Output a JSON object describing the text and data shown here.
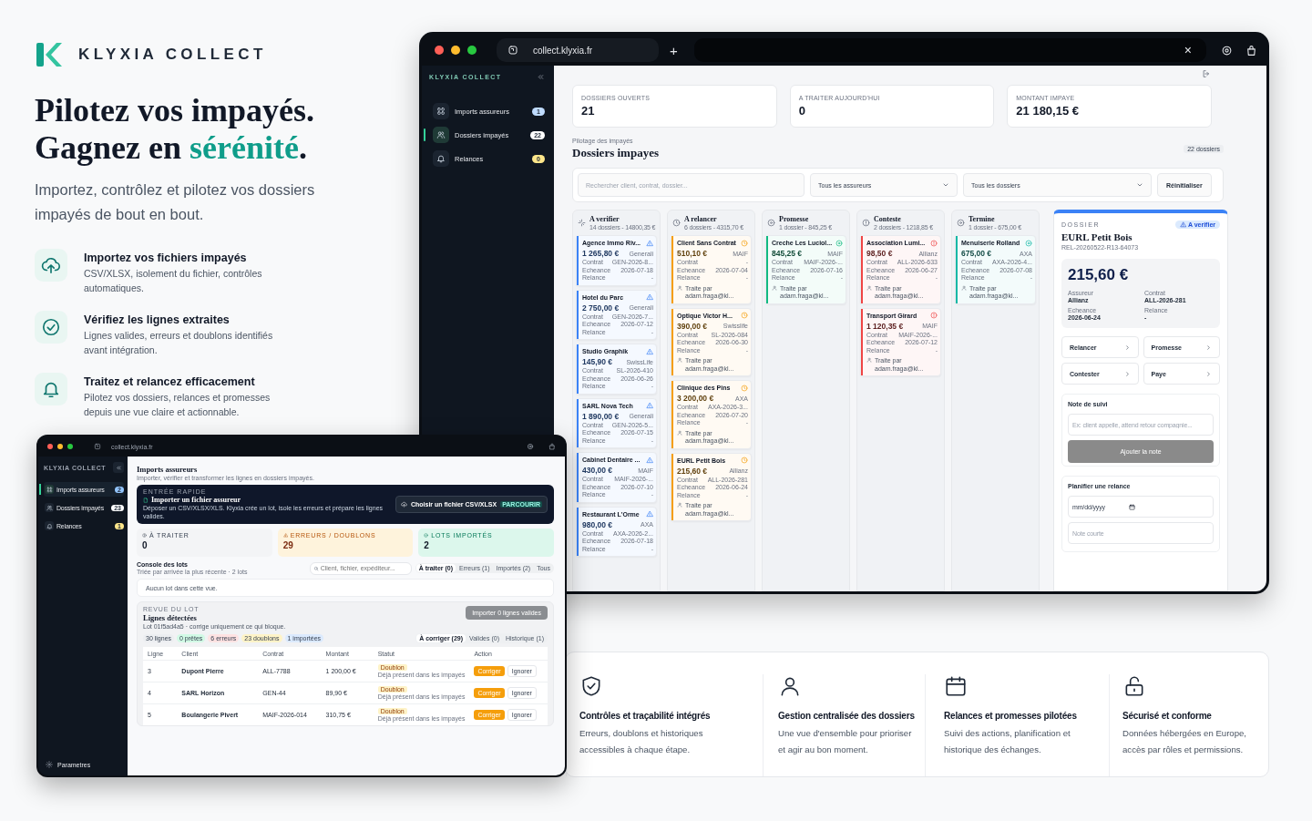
{
  "brand": {
    "name": "KLYXIA COLLECT"
  },
  "hero": {
    "title_line": "Pilotez vos impayés.",
    "title_lead": "Gagnez en ",
    "title_accent": "sérénité",
    "title_tail": ".",
    "subtitle": "Importez, contrôlez et pilotez vos dossiers impayés de bout en bout.",
    "features": [
      {
        "title": "Importez vos fichiers impayés",
        "text": "CSV/XLSX, isolement du fichier, contrôles automatiques."
      },
      {
        "title": "Vérifiez les lignes extraites",
        "text": "Lignes valides, erreurs et doublons identifiés avant intégration."
      },
      {
        "title": "Traitez et relancez efficacement",
        "text": "Pilotez vos dossiers, relances et promesses depuis une vue claire et actionnable."
      }
    ]
  },
  "main_window": {
    "url": "collect.klyxia.fr",
    "tab_new": "+",
    "tab_close": "×",
    "sidebar_brand": "KLYXIA COLLECT",
    "nav": [
      {
        "label": "Imports assureurs",
        "count": "1",
        "selected": false,
        "color": "#bfdbfe"
      },
      {
        "label": "Dossiers impayés",
        "count": "22",
        "selected": true,
        "color": "#ffffff"
      },
      {
        "label": "Relances",
        "count": "0",
        "selected": false,
        "color": "#fde68a"
      }
    ],
    "stats": [
      {
        "label": "DOSSIERS OUVERTS",
        "value": "21"
      },
      {
        "label": "A TRAITER AUJOURD'HUI",
        "value": "0"
      },
      {
        "label": "MONTANT IMPAYE",
        "value": "21 180,15 €"
      }
    ],
    "breadcrumb": "Pilotage des impayés",
    "title": "Dossiers impayes",
    "count": "22 dossiers",
    "search": {
      "placeholder": "Rechercher client, contrat, dossier..."
    },
    "selects": [
      "Tous les assureurs",
      "Tous les dossiers"
    ],
    "reset": "Réinitialiser",
    "columns": [
      {
        "title": "A verifier",
        "summary": "14 dossiers - 14800,35 €",
        "color": "#3b82f6",
        "cards": [
          {
            "name": "Agence Immo Riv...",
            "amount": "1 265,80 €",
            "insurer": "Generali",
            "rows": [
              {
                "label": "Contrat",
                "value": "GEN-2026-8..."
              },
              {
                "label": "Echeance",
                "value": "2026-07-18"
              },
              {
                "label": "Relance",
                "value": "-"
              }
            ]
          },
          {
            "name": "Hotel du Parc",
            "amount": "2 750,00 €",
            "insurer": "Generali",
            "rows": [
              {
                "label": "Contrat",
                "value": "GEN-2026-7..."
              },
              {
                "label": "Echeance",
                "value": "2026-07-12"
              },
              {
                "label": "Relance",
                "value": "-"
              }
            ]
          },
          {
            "name": "Studio Graphik",
            "amount": "145,90 €",
            "insurer": "SwissLife",
            "rows": [
              {
                "label": "Contrat",
                "value": "SL-2026-410"
              },
              {
                "label": "Echeance",
                "value": "2026-06-26"
              },
              {
                "label": "Relance",
                "value": "-"
              }
            ]
          },
          {
            "name": "SARL Nova Tech",
            "amount": "1 890,00 €",
            "insurer": "Generali",
            "rows": [
              {
                "label": "Contrat",
                "value": "GEN-2026-5..."
              },
              {
                "label": "Echeance",
                "value": "2026-07-15"
              },
              {
                "label": "Relance",
                "value": "-"
              }
            ]
          },
          {
            "name": "Cabinet Dentaire ...",
            "amount": "430,00 €",
            "insurer": "MAIF",
            "rows": [
              {
                "label": "Contrat",
                "value": "MAIF-2026-..."
              },
              {
                "label": "Echeance",
                "value": "2026-07-10"
              },
              {
                "label": "Relance",
                "value": "-"
              }
            ]
          },
          {
            "name": "Restaurant L'Orme",
            "amount": "980,00 €",
            "insurer": "AXA",
            "rows": [
              {
                "label": "Contrat",
                "value": "AXA-2026-2..."
              },
              {
                "label": "Echeance",
                "value": "2026-07-18"
              },
              {
                "label": "Relance",
                "value": "-"
              }
            ]
          }
        ]
      },
      {
        "title": "A relancer",
        "summary": "6 dossiers - 4315,70 €",
        "color": "#f59e0b",
        "cards": [
          {
            "name": "Client Sans Contrat",
            "amount": "510,10 €",
            "insurer": "MAIF",
            "rows": [
              {
                "label": "Contrat",
                "value": "-"
              },
              {
                "label": "Echeance",
                "value": "2026-07-04"
              },
              {
                "label": "Relance",
                "value": "-"
              }
            ],
            "footer": "Traite par adam.fraga@kl..."
          },
          {
            "name": "Optique Victor H...",
            "amount": "390,00 €",
            "insurer": "Swisslife",
            "rows": [
              {
                "label": "Contrat",
                "value": "SL-2026-084"
              },
              {
                "label": "Echeance",
                "value": "2026-06-30"
              },
              {
                "label": "Relance",
                "value": "-"
              }
            ],
            "footer": "Traite par adam.fraga@kl..."
          },
          {
            "name": "Clinique des Pins",
            "amount": "3 200,00 €",
            "insurer": "AXA",
            "rows": [
              {
                "label": "Contrat",
                "value": "AXA-2026-3..."
              },
              {
                "label": "Echeance",
                "value": "2026-07-20"
              },
              {
                "label": "Relance",
                "value": "-"
              }
            ],
            "footer": "Traite par adam.fraga@kl..."
          },
          {
            "name": "EURL Petit Bois",
            "amount": "215,60 €",
            "insurer": "Allianz",
            "rows": [
              {
                "label": "Contrat",
                "value": "ALL-2026-281"
              },
              {
                "label": "Echeance",
                "value": "2026-06-24"
              },
              {
                "label": "Relance",
                "value": "-"
              }
            ],
            "footer": "Traite par adam.fraga@kl..."
          }
        ]
      },
      {
        "title": "Promesse",
        "summary": "1 dossier - 845,25 €",
        "color": "#10b981",
        "cards": [
          {
            "name": "Creche Les Luciol...",
            "amount": "845,25 €",
            "insurer": "MAIF",
            "rows": [
              {
                "label": "Contrat",
                "value": "MAIF-2026-..."
              },
              {
                "label": "Echeance",
                "value": "2026-07-16"
              },
              {
                "label": "Relance",
                "value": "-"
              }
            ],
            "footer": "Traite par adam.fraga@kl..."
          }
        ]
      },
      {
        "title": "Conteste",
        "summary": "2 dossiers - 1218,85 €",
        "color": "#ef4444",
        "cards": [
          {
            "name": "Association Lumi...",
            "amount": "98,50 €",
            "insurer": "Allianz",
            "rows": [
              {
                "label": "Contrat",
                "value": "ALL-2026-633"
              },
              {
                "label": "Echeance",
                "value": "2026-06-27"
              },
              {
                "label": "Relance",
                "value": "-"
              }
            ],
            "footer": "Traite par adam.fraga@kl..."
          },
          {
            "name": "Transport Girard",
            "amount": "1 120,35 €",
            "insurer": "MAIF",
            "rows": [
              {
                "label": "Contrat",
                "value": "MAIF-2026-..."
              },
              {
                "label": "Echeance",
                "value": "2026-07-12"
              },
              {
                "label": "Relance",
                "value": "-"
              }
            ],
            "footer": "Traite par adam.fraga@kl..."
          }
        ]
      },
      {
        "title": "Termine",
        "summary": "1 dossier - 675,00 €",
        "color": "#14b8a6",
        "cards": [
          {
            "name": "Menuiserie Rolland",
            "amount": "675,00 €",
            "insurer": "AXA",
            "rows": [
              {
                "label": "Contrat",
                "value": "AXA-2026-4..."
              },
              {
                "label": "Echeance",
                "value": "2026-07-08"
              },
              {
                "label": "Relance",
                "value": "-"
              }
            ],
            "footer": "Traite par adam.fraga@kl..."
          }
        ]
      }
    ],
    "detail": {
      "label": "DOSSIER",
      "badge": "A verifier",
      "title": "EURL Petit Bois",
      "reference": "REL-20260522-R13-64073",
      "amount": "215,60 €",
      "fields": [
        {
          "label": "Assureur",
          "value": "Allianz"
        },
        {
          "label": "Contrat",
          "value": "ALL-2026-281"
        },
        {
          "label": "Echeance",
          "value": "2026-06-24"
        },
        {
          "label": "Relance",
          "value": "-"
        }
      ],
      "actions": [
        "Relancer",
        "Promesse",
        "Contester",
        "Paye"
      ],
      "note": {
        "title": "Note de suivi",
        "placeholder": "Ex: client appelle, attend retour compagnie...",
        "button": "Ajouter la note",
        "disabled": true
      },
      "plan": {
        "title": "Planifier une relance",
        "date_placeholder": "mm/dd/yyyy",
        "note_placeholder": "Note courte"
      }
    }
  },
  "small_window": {
    "url": "collect.klyxia.fr",
    "sidebar_brand": "KLYXIA COLLECT",
    "nav": [
      {
        "label": "Imports assureurs",
        "count": "2",
        "selected": true,
        "color": "#93c5fd"
      },
      {
        "label": "Dossiers impayés",
        "count": "23",
        "selected": false,
        "color": "#ffffff"
      },
      {
        "label": "Relances",
        "count": "1",
        "selected": false,
        "color": "#fde68a"
      }
    ],
    "settings": "Parametres",
    "title": "Imports assureurs",
    "subtitle": "Importer, vérifier et transformer les lignes en dossiers impayés.",
    "banner": {
      "label": "ENTRÉE RAPIDE",
      "title": "Importer un fichier assureur",
      "text": "Déposer un CSV/XLSX/XLS. Klyxia crée un lot, isole les erreurs et prépare les lignes valides.",
      "button": "Choisir un fichier CSV/XLSX",
      "button_tag": "PARCOURIR"
    },
    "stats": [
      {
        "label": "À TRAITER",
        "value": "0",
        "color": "#f3f4f6"
      },
      {
        "label": "ERREURS / DOUBLONS",
        "value": "29",
        "color": "#fef3dc"
      },
      {
        "label": "LOTS IMPORTÉS",
        "value": "2",
        "color": "#dcf7ec"
      }
    ],
    "console": {
      "title": "Console des lots",
      "subtitle": "Triée par arrivée la plus récente · 2 lots",
      "search_placeholder": "Client, fichier, expéditeur...",
      "tabs": [
        {
          "label": "À traiter (0)",
          "selected": true
        },
        {
          "label": "Erreurs (1)",
          "selected": false
        },
        {
          "label": "Importés (2)",
          "selected": false
        },
        {
          "label": "Tous",
          "selected": false
        }
      ],
      "empty": "Aucun lot dans cette vue."
    },
    "review": {
      "label": "REVUE DU LOT",
      "title": "Lignes détectées",
      "subtitle": "Lot 01f5ad4a5 · corrige uniquement ce qui bloque.",
      "button": "Importer 0 lignes valides",
      "disabled": true,
      "chips": [
        {
          "label": "30 lignes",
          "color": "#eceef1"
        },
        {
          "label": "0 prêtes",
          "color": "#d1fae5"
        },
        {
          "label": "6 erreurs",
          "color": "#fee2e2"
        },
        {
          "label": "23 doublons",
          "color": "#fef3c7"
        },
        {
          "label": "1 importées",
          "color": "#dbeafe"
        }
      ],
      "tabs": [
        {
          "label": "À corriger (29)",
          "selected": true
        },
        {
          "label": "Valides (0)",
          "selected": false
        },
        {
          "label": "Historique (1)",
          "selected": false
        }
      ]
    },
    "table": {
      "columns": [
        "Ligne",
        "Client",
        "Contrat",
        "Montant",
        "Statut",
        "Action"
      ],
      "rows": [
        {
          "line": "3",
          "client": "Dupont Pierre",
          "contract": "ALL-7788",
          "amount": "1 200,00 €",
          "status": "Doublon",
          "status_note": "Déjà présent dans les impayés",
          "fix": "Corriger",
          "ignore": "Ignorer"
        },
        {
          "line": "4",
          "client": "SARL Horizon",
          "contract": "GEN-44",
          "amount": "89,90 €",
          "status": "Doublon",
          "status_note": "Déjà présent dans les impayés",
          "fix": "Corriger",
          "ignore": "Ignorer"
        },
        {
          "line": "5",
          "client": "Boulangerie Pivert",
          "contract": "MAIF-2026-014",
          "amount": "310,75 €",
          "status": "Doublon",
          "status_note": "Déjà présent dans les impayés",
          "fix": "Corriger",
          "ignore": "Ignorer"
        }
      ]
    }
  },
  "benefits": [
    {
      "title": "Contrôles et traçabilité intégrés",
      "text": "Erreurs, doublons et historiques accessibles à chaque étape."
    },
    {
      "title": "Gestion centralisée des dossiers",
      "text": "Une vue d'ensemble pour prioriser et agir au bon moment."
    },
    {
      "title": "Relances et promesses pilotées",
      "text": "Suivi des actions, planification et historique des échanges."
    },
    {
      "title": "Sécurisé et conforme",
      "text": "Données hébergées en Europe, accès par rôles et permissions."
    }
  ]
}
